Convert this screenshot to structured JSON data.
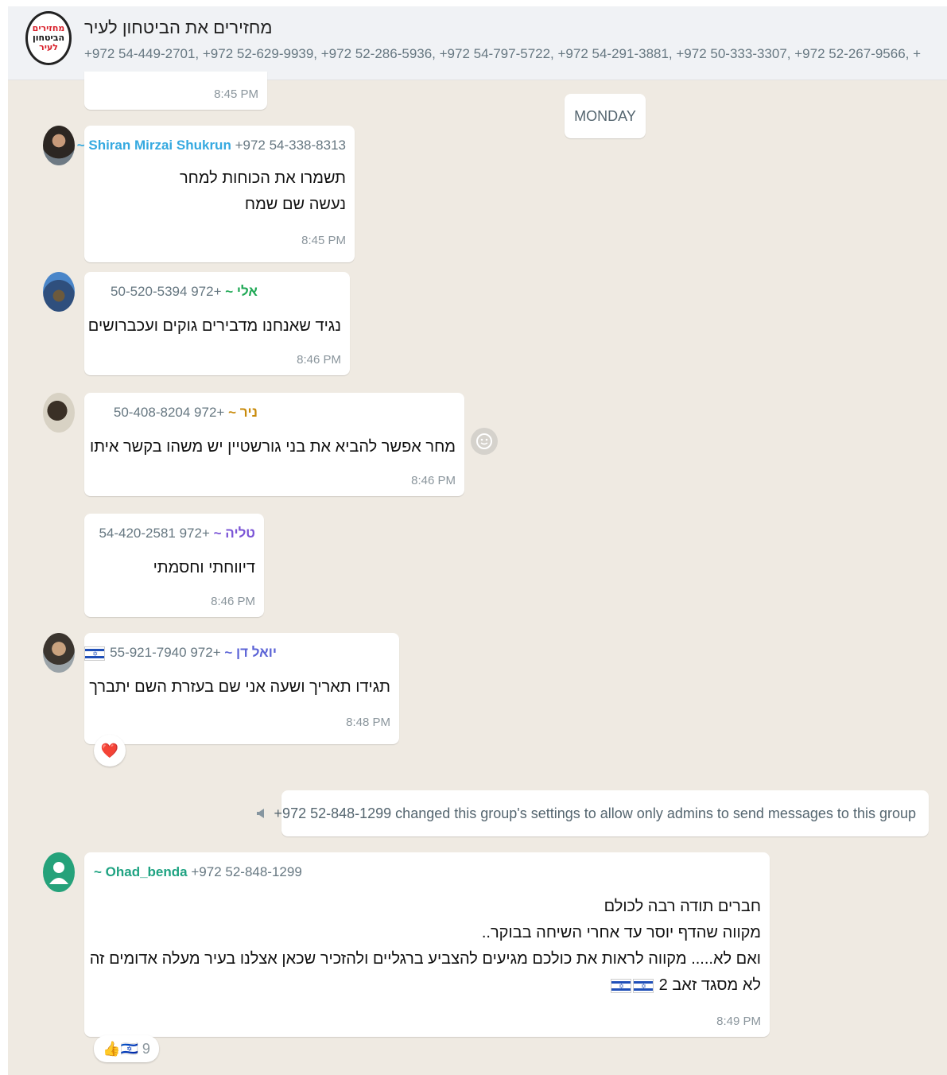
{
  "header": {
    "avatar_lines": [
      "מחזירים",
      "הביטחון",
      "לעיר"
    ],
    "title": "מחזירים את הביטחון לעיר",
    "members": "+972 54-449-2701, +972 52-629-9939, +972 52-286-5936, +972 54-797-5722, +972 54-291-3881, +972 50-333-3307, +972 52-267-9566, +"
  },
  "day_divider": "MONDAY",
  "prev_time": "8:45 PM",
  "messages": [
    {
      "sender_name": "~ Shiran Mirzai Shukrun",
      "sender_phone": "+972 54-338-8313",
      "name_color": "#35a9e0",
      "lines": [
        "תשמרו את הכוחות למחר",
        "נעשה שם שמח"
      ],
      "time": "8:45 PM"
    },
    {
      "sender_name": "אלי ~",
      "sender_phone": "+972 50-520-5394",
      "name_color": "#1fa855",
      "lines": [
        "נגיד שאנחנו מדבירים גוקים ועכברושים"
      ],
      "time": "8:46 PM"
    },
    {
      "sender_name": "ניר ~",
      "sender_phone": "+972 50-408-8204",
      "name_color": "#c88a0a",
      "lines": [
        "מחר אפשר להביא את בני גורשטיין יש משהו בקשר איתו"
      ],
      "time": "8:46 PM"
    },
    {
      "sender_name": "טליה ~",
      "sender_phone": "+972 54-420-2581",
      "name_color": "#7b55d6",
      "lines": [
        "דיווחתי וחסמתי"
      ],
      "time": "8:46 PM"
    },
    {
      "sender_name": "יואל דן ~",
      "sender_phone": "+972 55-921-7940",
      "name_color": "#5b63d6",
      "lines": [
        "תגידו תאריך ושעה אני שם בעזרת השם יתברך"
      ],
      "time": "8:48 PM",
      "reaction": "❤️"
    },
    {
      "sender_name": "~ Ohad_benda",
      "sender_phone": "+972 52-848-1299",
      "name_color": "#1fa382",
      "lines": [
        "חברים תודה רבה לכולם",
        "מקווה שהדף יוסר עד אחרי השיחה בבוקר..",
        "ואם לא..... מקווה לראות את כולכם מגיעים להצביע ברגליים ולהזכיר שכאן אצלנו בעיר מעלה אדומים זה",
        "לא מסגד זאב 2"
      ],
      "time": "8:49 PM",
      "reaction": "👍🇮🇱 9"
    }
  ],
  "system_message": "+972 52-848-1299 changed this group's settings to allow only admins to send messages to this group",
  "icons": {
    "group_avatar": "group-logo-icon",
    "emoji_button": "smiley-icon",
    "system": "megaphone-icon",
    "default_avatar": "person-icon"
  },
  "colors": {
    "chat_bg": "#efeae2",
    "bubble": "#ffffff",
    "header": "#f0f2f5"
  }
}
